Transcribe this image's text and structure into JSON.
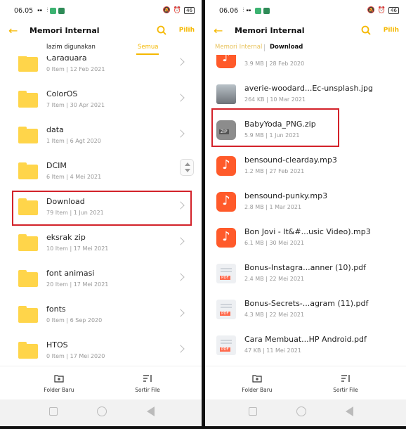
{
  "colors": {
    "accent": "#f5b800",
    "highlight": "#d3222a",
    "folder": "#ffd54a",
    "music": "#ff5a2a"
  },
  "left": {
    "status": {
      "time": "06.05",
      "battery": "46"
    },
    "appbar": {
      "title": "Memori Internal",
      "action": "Pilih"
    },
    "tabs": {
      "recent": "lazim digunakan",
      "all": "Semua"
    },
    "folders": [
      {
        "name": "Caraduara",
        "meta": "0 Item | 12 Feb 2021"
      },
      {
        "name": "ColorOS",
        "meta": "7 Item | 30 Apr 2021"
      },
      {
        "name": "data",
        "meta": "1 Item | 6 Agt 2020"
      },
      {
        "name": "DCIM",
        "meta": "6 Item | 4 Mei 2021"
      },
      {
        "name": "Download",
        "meta": "79 Item | 1 Jun 2021"
      },
      {
        "name": "eksrak zip",
        "meta": "10 Item | 17 Mei 2021"
      },
      {
        "name": "font animasi",
        "meta": "20 Item | 17 Mei 2021"
      },
      {
        "name": "fonts",
        "meta": "0 Item | 6 Sep 2020"
      },
      {
        "name": "HTOS",
        "meta": "0 Item | 17 Mei 2020"
      }
    ],
    "bottom": {
      "new_folder": "Folder Baru",
      "sort": "Sortir File"
    }
  },
  "right": {
    "status": {
      "time": "06.06",
      "battery": "46"
    },
    "appbar": {
      "title": "Memori Internal",
      "action": "Pilih"
    },
    "breadcrumb": {
      "root": "Memori Internal",
      "current": "Download"
    },
    "files": [
      {
        "name": "",
        "meta": "3.9 MB | 28 Feb 2020",
        "icon": "music-icon"
      },
      {
        "name": "averie-woodard...Ec-unsplash.jpg",
        "meta": "264 KB | 10 Mar 2021",
        "icon": "image-icon"
      },
      {
        "name": "BabyYoda_PNG.zip",
        "meta": "5.9 MB | 1 Jun 2021",
        "icon": "zip-icon"
      },
      {
        "name": "bensound-clearday.mp3",
        "meta": "1.2 MB | 27 Feb 2021",
        "icon": "music-icon"
      },
      {
        "name": "bensound-punky.mp3",
        "meta": "2.8 MB | 1 Mar 2021",
        "icon": "music-icon"
      },
      {
        "name": "Bon Jovi - It&#...usic Video).mp3",
        "meta": "6.1 MB | 30 Mei 2021",
        "icon": "music-icon"
      },
      {
        "name": "Bonus-Instagra...anner (10).pdf",
        "meta": "2.4 MB | 22 Mei 2021",
        "icon": "pdf-icon"
      },
      {
        "name": "Bonus-Secrets-...agram (11).pdf",
        "meta": "4.3 MB | 22 Mei 2021",
        "icon": "pdf-icon"
      },
      {
        "name": "Cara Membuat...HP Android.pdf",
        "meta": "47 KB | 11 Mei 2021",
        "icon": "pdf-icon"
      }
    ],
    "bottom": {
      "new_folder": "Folder Baru",
      "sort": "Sortir File"
    }
  }
}
